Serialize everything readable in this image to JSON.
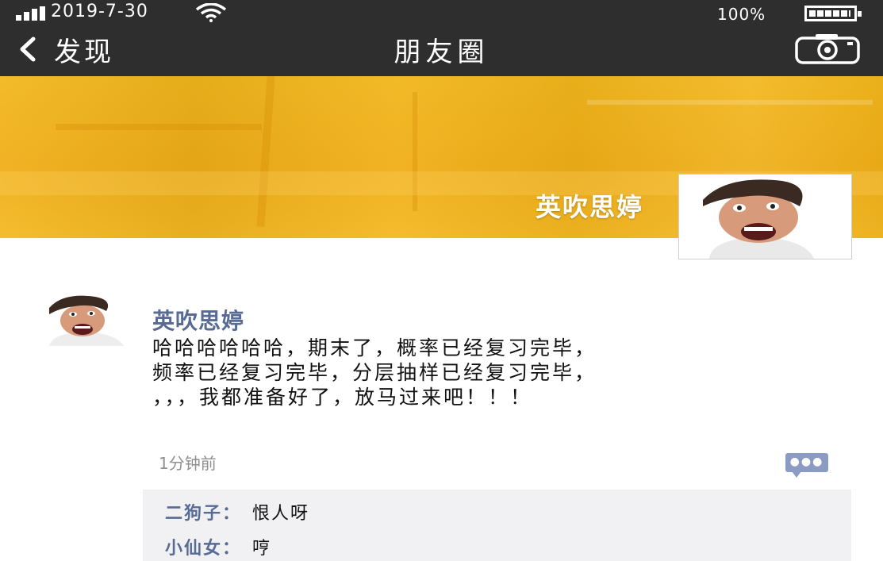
{
  "status_bar": {
    "time": "2019-7-30",
    "battery_percent": "100%",
    "signal_icon": "signal-bars-icon",
    "wifi_icon": "wifi-icon",
    "battery_icon": "battery-icon"
  },
  "nav": {
    "back_label": "发现",
    "title": "朋友圈",
    "camera_icon": "camera-icon"
  },
  "cover": {
    "name": "英吹思婷",
    "colors": {
      "primary": "#f0ae17"
    }
  },
  "post": {
    "author": "英吹思婷",
    "lines": [
      "哈哈哈哈哈哈，期末了，概率已经复习完毕，",
      "频率已经复习完毕，分层抽样已经复习完毕，",
      "，，，我都准备好了，放马过来吧！！！"
    ],
    "time": "1分钟前",
    "more_icon": "more-comment-icon"
  },
  "comments": [
    {
      "name": "二狗子：",
      "text": "恨人呀"
    },
    {
      "name": "小仙女：",
      "text": "哼"
    }
  ],
  "colors": {
    "topbar": "#2e2e2e",
    "link_blue": "#576b95",
    "comment_bg": "#f1f1f3"
  }
}
